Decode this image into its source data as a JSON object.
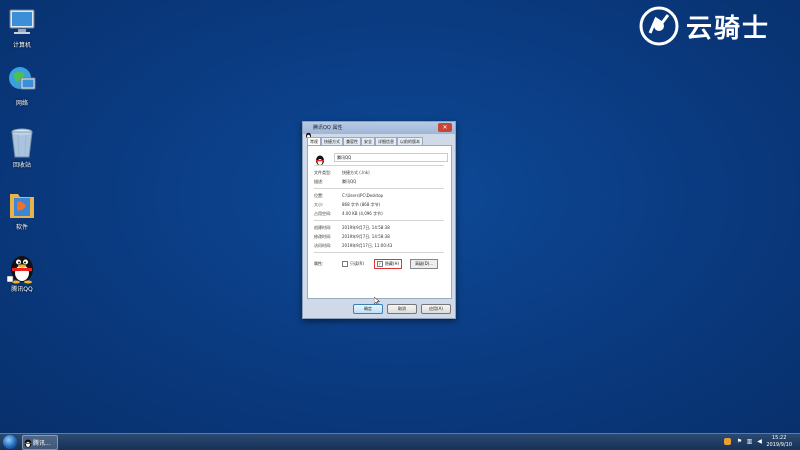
{
  "desktop": {
    "icons": [
      {
        "label": "计算机"
      },
      {
        "label": "网络"
      },
      {
        "label": "回收站"
      },
      {
        "label": "软件"
      },
      {
        "label": "腾讯QQ"
      }
    ],
    "logo_text": "云骑士"
  },
  "dialog": {
    "title": "腾讯QQ 属性",
    "tabs": [
      "常规",
      "快捷方式",
      "兼容性",
      "安全",
      "详细信息",
      "以前的版本"
    ],
    "name": "腾讯QQ",
    "rows": [
      {
        "key": "文件类型:",
        "value": "快捷方式 (.lnk)"
      },
      {
        "key": "描述:",
        "value": "腾讯QQ"
      },
      {
        "key": "位置:",
        "value": "C:\\Users\\PC\\Desktop"
      },
      {
        "key": "大小:",
        "value": "868 字节 (868 字节)"
      },
      {
        "key": "占用空间:",
        "value": "4.00 KB (4,096 字节)"
      },
      {
        "key": "创建时间:",
        "value": "2019年9月7日, 14:58:38"
      },
      {
        "key": "修改时间:",
        "value": "2019年9月7日, 14:58:38"
      },
      {
        "key": "访问时间:",
        "value": "2019年9月17日, 11:00:43"
      }
    ],
    "attr_label": "属性:",
    "readonly_label": "只读(R)",
    "hidden_label": "隐藏(H)",
    "advanced_label": "高级(D)...",
    "ok_label": "确定",
    "cancel_label": "取消",
    "apply_label": "应用(A)",
    "close_symbol": "✕"
  },
  "taskbar": {
    "task_label": "腾讯...",
    "time": "15:22",
    "date": "2019/9/10"
  },
  "colors": {
    "desktop_bg": "#0a3a80",
    "highlight": "#dd3333"
  }
}
